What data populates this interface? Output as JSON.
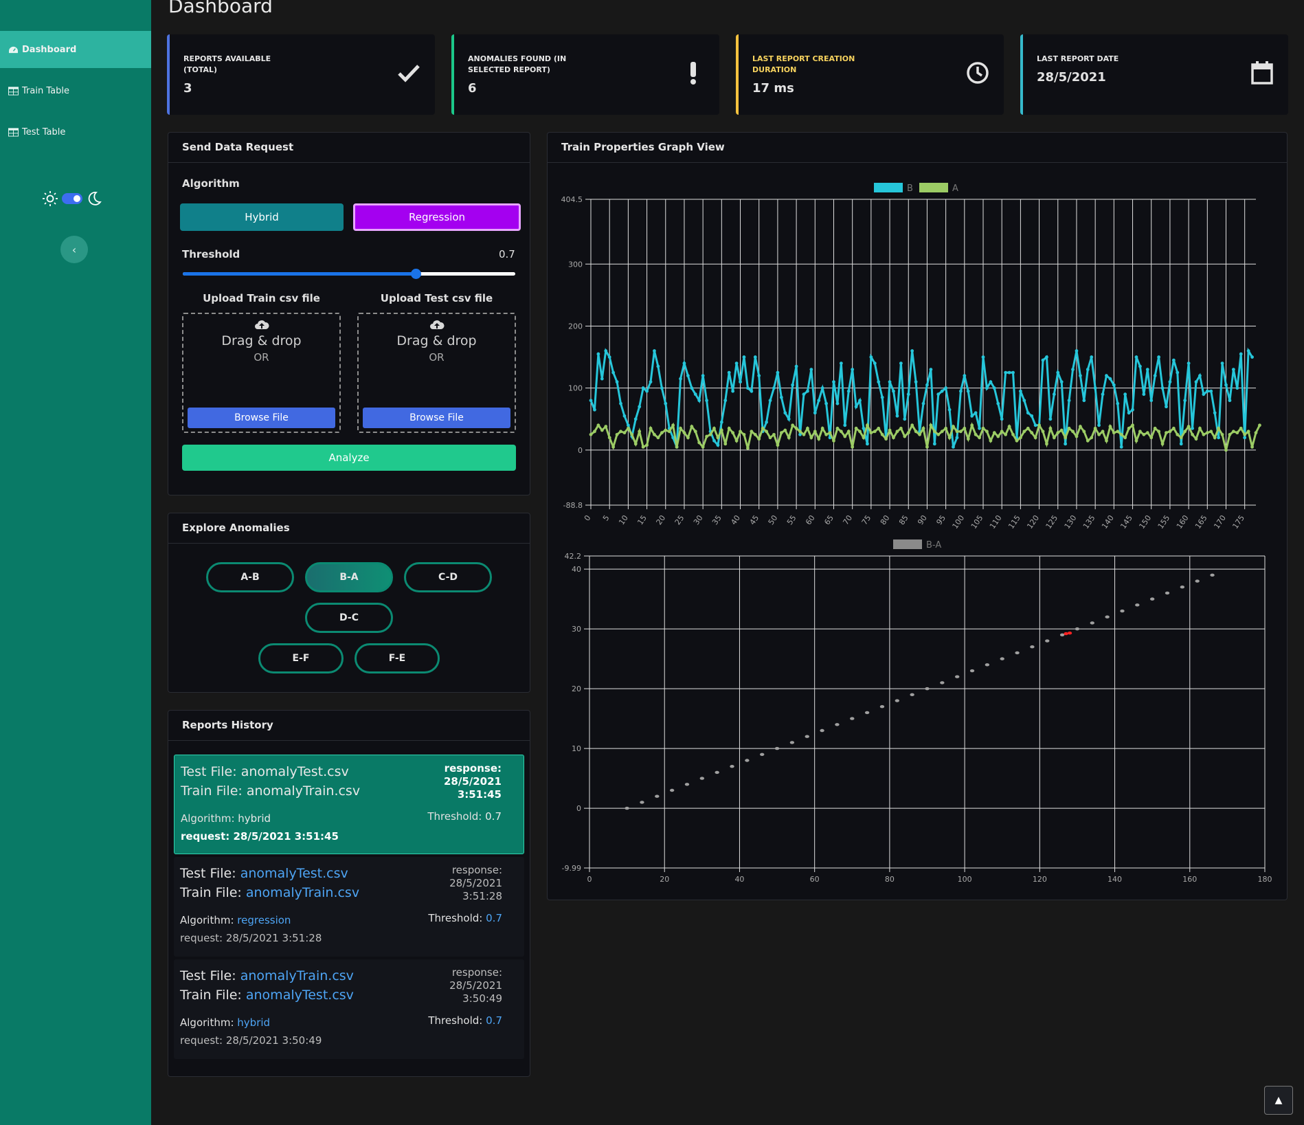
{
  "sidebar": {
    "items": [
      {
        "label": "Dashboard",
        "active": true
      },
      {
        "label": "Train Table",
        "active": false
      },
      {
        "label": "Test Table",
        "active": false
      }
    ],
    "theme_toggle": "dark",
    "collapse_icon": "chevron-left-icon"
  },
  "page": {
    "title": "Dashboard"
  },
  "stats": [
    {
      "label": "REPORTS AVAILABLE (TOTAL)",
      "value": "3",
      "icon": "check-icon",
      "color": "#4e73df"
    },
    {
      "label": "ANOMALIES FOUND (IN SELECTED REPORT)",
      "value": "6",
      "icon": "exclamation-icon",
      "color": "#1cc88a"
    },
    {
      "label": "LAST REPORT CREATION DURATION",
      "value": "17 ms",
      "icon": "clock-icon",
      "color": "#f6c23e"
    },
    {
      "label": "LAST REPORT DATE",
      "value": "28/5/2021",
      "icon": "calendar-icon",
      "color": "#36b9cc"
    }
  ],
  "send": {
    "title": "Send Data Request",
    "algorithm_label": "Algorithm",
    "hybrid_label": "Hybrid",
    "regression_label": "Regression",
    "selected_algorithm": "Regression",
    "threshold_label": "Threshold",
    "threshold_value": "0.7",
    "threshold_fraction": 0.7,
    "upload_train_label": "Upload Train csv file",
    "upload_test_label": "Upload Test csv file",
    "drag_label": "Drag & drop",
    "or_label": "OR",
    "browse_label": "Browse File",
    "analyze_label": "Analyze"
  },
  "explore": {
    "title": "Explore Anomalies",
    "pairs": [
      "A-B",
      "B-A",
      "C-D",
      "D-C",
      "E-F",
      "F-E"
    ],
    "selected": "B-A"
  },
  "history": {
    "title": "Reports History",
    "reports": [
      {
        "test_prefix": "Test File:",
        "test_file": "anomalyTest.csv",
        "train_prefix": "Train File:",
        "train_file": "anomalyTrain.csv",
        "response_label": "response:",
        "response_date": "28/5/2021",
        "response_time": "3:51:45",
        "algorithm_label": "Algorithm:",
        "algorithm": "hybrid",
        "threshold_label": "Threshold:",
        "threshold": "0.7",
        "request_label": "request:",
        "request": "28/5/2021 3:51:45"
      },
      {
        "test_prefix": "Test File:",
        "test_file": "anomalyTest.csv",
        "train_prefix": "Train File:",
        "train_file": "anomalyTrain.csv",
        "response_label": "response:",
        "response_date": "28/5/2021",
        "response_time": "3:51:28",
        "algorithm_label": "Algorithm:",
        "algorithm": "regression",
        "threshold_label": "Threshold:",
        "threshold": "0.7",
        "request_label": "request:",
        "request": "28/5/2021 3:51:28"
      },
      {
        "test_prefix": "Test File:",
        "test_file": "anomalyTrain.csv",
        "train_prefix": "Train File:",
        "train_file": "anomalyTest.csv",
        "response_label": "response:",
        "response_date": "28/5/2021",
        "response_time": "3:50:49",
        "algorithm_label": "Algorithm:",
        "algorithm": "hybrid",
        "threshold_label": "Threshold:",
        "threshold": "0.7",
        "request_label": "request:",
        "request": "28/5/2021 3:50:49"
      }
    ]
  },
  "graph": {
    "title": "Train Properties Graph View"
  },
  "chart_data": [
    {
      "type": "line",
      "legend": [
        "B",
        "A"
      ],
      "legend_position": "top",
      "colors": {
        "B": "#26c6da",
        "A": "#9ccc65"
      },
      "ylim": [
        -88.8,
        404.5
      ],
      "yticks": [
        404.5,
        300,
        200,
        100,
        0,
        -88.8
      ],
      "xticks": [
        0,
        5,
        10,
        15,
        20,
        25,
        30,
        35,
        40,
        45,
        50,
        55,
        60,
        65,
        70,
        75,
        80,
        85,
        90,
        95,
        100,
        105,
        110,
        115,
        120,
        125,
        130,
        135,
        140,
        145,
        150,
        155,
        160,
        165,
        170,
        175
      ],
      "x_range": [
        0,
        178
      ],
      "grid": true,
      "series": [
        {
          "name": "B",
          "values": [
            80,
            65,
            155,
            115,
            160,
            150,
            125,
            110,
            75,
            55,
            40,
            22,
            50,
            70,
            100,
            95,
            110,
            160,
            135,
            100,
            75,
            35,
            20,
            5,
            115,
            140,
            120,
            100,
            90,
            80,
            120,
            80,
            30,
            15,
            8,
            45,
            80,
            125,
            95,
            140,
            110,
            150,
            100,
            95,
            150,
            120,
            30,
            45,
            80,
            100,
            125,
            85,
            60,
            50,
            105,
            135,
            25,
            90,
            95,
            130,
            60,
            80,
            100,
            75,
            20,
            110,
            75,
            140,
            40,
            95,
            130,
            70,
            80,
            35,
            10,
            150,
            140,
            110,
            85,
            20,
            110,
            95,
            55,
            140,
            50,
            90,
            160,
            110,
            30,
            75,
            105,
            130,
            10,
            90,
            95,
            100,
            65,
            5,
            20,
            95,
            120,
            95,
            55,
            60,
            35,
            150,
            100,
            110,
            100,
            75,
            50,
            125,
            125,
            125,
            20,
            95,
            80,
            60,
            55,
            40,
            40,
            145,
            150,
            50,
            90,
            125,
            110,
            10,
            80,
            130,
            160,
            120,
            80,
            130,
            150,
            100,
            40,
            90,
            120,
            115,
            105,
            75,
            5,
            90,
            60,
            65,
            150,
            135,
            90,
            130,
            80,
            120,
            150,
            100,
            70,
            110,
            145,
            125,
            10,
            80,
            140,
            35,
            110,
            120,
            90,
            95,
            95,
            60,
            20,
            140,
            105,
            80,
            130,
            100,
            155,
            20,
            160,
            150
          ]
        },
        {
          "name": "A",
          "values": [
            25,
            30,
            40,
            32,
            38,
            20,
            5,
            25,
            30,
            28,
            35,
            25,
            10,
            30,
            5,
            8,
            35,
            25,
            20,
            28,
            32,
            30,
            40,
            5,
            35,
            28,
            20,
            38,
            30,
            12,
            5,
            22,
            25,
            35,
            20,
            32,
            10,
            35,
            28,
            15,
            30,
            25,
            3,
            30,
            25,
            18,
            35,
            30,
            20,
            25,
            8,
            28,
            32,
            20,
            40,
            35,
            30,
            25,
            35,
            20,
            30,
            18,
            35,
            25,
            28,
            15,
            35,
            30,
            22,
            30,
            5,
            35,
            30,
            20,
            40,
            28,
            30,
            35,
            25,
            18,
            32,
            20,
            30,
            35,
            22,
            28,
            40,
            30,
            25,
            35,
            5,
            40,
            30,
            25,
            30,
            35,
            20,
            38,
            30,
            30,
            35,
            18,
            40,
            25,
            20,
            35,
            30,
            15,
            28,
            22,
            30,
            25,
            38,
            25,
            15,
            20,
            30,
            35,
            28,
            20,
            40,
            30,
            10,
            35,
            20,
            28,
            32,
            20,
            35,
            30,
            22,
            38,
            30,
            15,
            20,
            35,
            25,
            30,
            15,
            38,
            28,
            30,
            25,
            20,
            35,
            40,
            15,
            30,
            25,
            28,
            20,
            35,
            30,
            10,
            28,
            30,
            35,
            25,
            20,
            30,
            38,
            25,
            18,
            35,
            25,
            28,
            30,
            20,
            35,
            25,
            0,
            25,
            30,
            28,
            35,
            25,
            30,
            5,
            28,
            40
          ]
        }
      ]
    },
    {
      "type": "scatter",
      "legend": [
        "B-A"
      ],
      "legend_position": "top",
      "ylim": [
        -9.99,
        42.2
      ],
      "yticks": [
        42.2,
        40,
        30,
        20,
        10,
        0,
        -9.99
      ],
      "xlim": [
        0,
        180
      ],
      "xticks": [
        0,
        20,
        40,
        60,
        80,
        100,
        120,
        140,
        160,
        180
      ],
      "grid": true,
      "colors": {
        "normal": "#a0a0a0",
        "anomaly": "#ff2222"
      },
      "points": [
        [
          10,
          0
        ],
        [
          14,
          1
        ],
        [
          18,
          2
        ],
        [
          22,
          3
        ],
        [
          26,
          4
        ],
        [
          30,
          5
        ],
        [
          34,
          6
        ],
        [
          38,
          7
        ],
        [
          42,
          8
        ],
        [
          46,
          9
        ],
        [
          50,
          10
        ],
        [
          54,
          11
        ],
        [
          58,
          12
        ],
        [
          62,
          13
        ],
        [
          66,
          14
        ],
        [
          70,
          15
        ],
        [
          74,
          16
        ],
        [
          78,
          17
        ],
        [
          82,
          18
        ],
        [
          86,
          19
        ],
        [
          90,
          20
        ],
        [
          94,
          21
        ],
        [
          98,
          22
        ],
        [
          102,
          23
        ],
        [
          106,
          24
        ],
        [
          110,
          25
        ],
        [
          114,
          26
        ],
        [
          118,
          27
        ],
        [
          122,
          28
        ],
        [
          126,
          29
        ],
        [
          130,
          30
        ],
        [
          134,
          31
        ],
        [
          138,
          32
        ],
        [
          142,
          33
        ],
        [
          146,
          34
        ],
        [
          150,
          35
        ],
        [
          154,
          36
        ],
        [
          158,
          37
        ],
        [
          162,
          38
        ],
        [
          166,
          39
        ]
      ],
      "anomalies": [
        [
          127,
          29.2
        ],
        [
          128,
          29.3
        ]
      ]
    }
  ]
}
